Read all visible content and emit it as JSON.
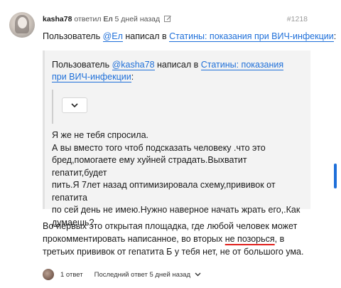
{
  "post": {
    "author": "kasha78",
    "reply_text": "ответил",
    "reply_to": "Ел",
    "time": "5 дней назад",
    "number": "#1218"
  },
  "mention_line": {
    "prefix": "Пользователь ",
    "user": "@Ел",
    "mid": " написал в ",
    "topic": "Статины: показания при ВИЧ-инфекции",
    "suffix": ":"
  },
  "quote": {
    "prefix": "Пользователь ",
    "user": "@kasha78",
    "mid": " написал в ",
    "topic": "Статины: показания при ВИЧ-инфекции",
    "suffix": ":",
    "lines": [
      "Я же не тебя спросила.",
      "А вы вместо того чтоб подсказать человеку .что это",
      "бред,помогаете ему хуйней страдать.Выхватит гепатит,будет",
      "пить.Я 7лет назад оптимизировала схему,прививок от гепатита",
      "по сей день не имею.Нужно наверное начать жрать его,.Как",
      "думаешь?"
    ]
  },
  "body": {
    "before": "Во-первых это открытая площадка, где любой человек может прокомментировать написанное, во вторых ",
    "highlight": "не позорься",
    "after": ", в третьих прививок от гепатита Б у тебя нет, не от большого ума."
  },
  "footer": {
    "replies": "1 ответ",
    "last_reply": "Последний ответ 5 дней назад"
  },
  "icons": {
    "edit": "edit-icon",
    "collapse": "chevron-down-icon",
    "expand": "chevron-down-icon"
  },
  "colors": {
    "link": "#1e6fd9",
    "highlight_underline": "#e0201d"
  }
}
